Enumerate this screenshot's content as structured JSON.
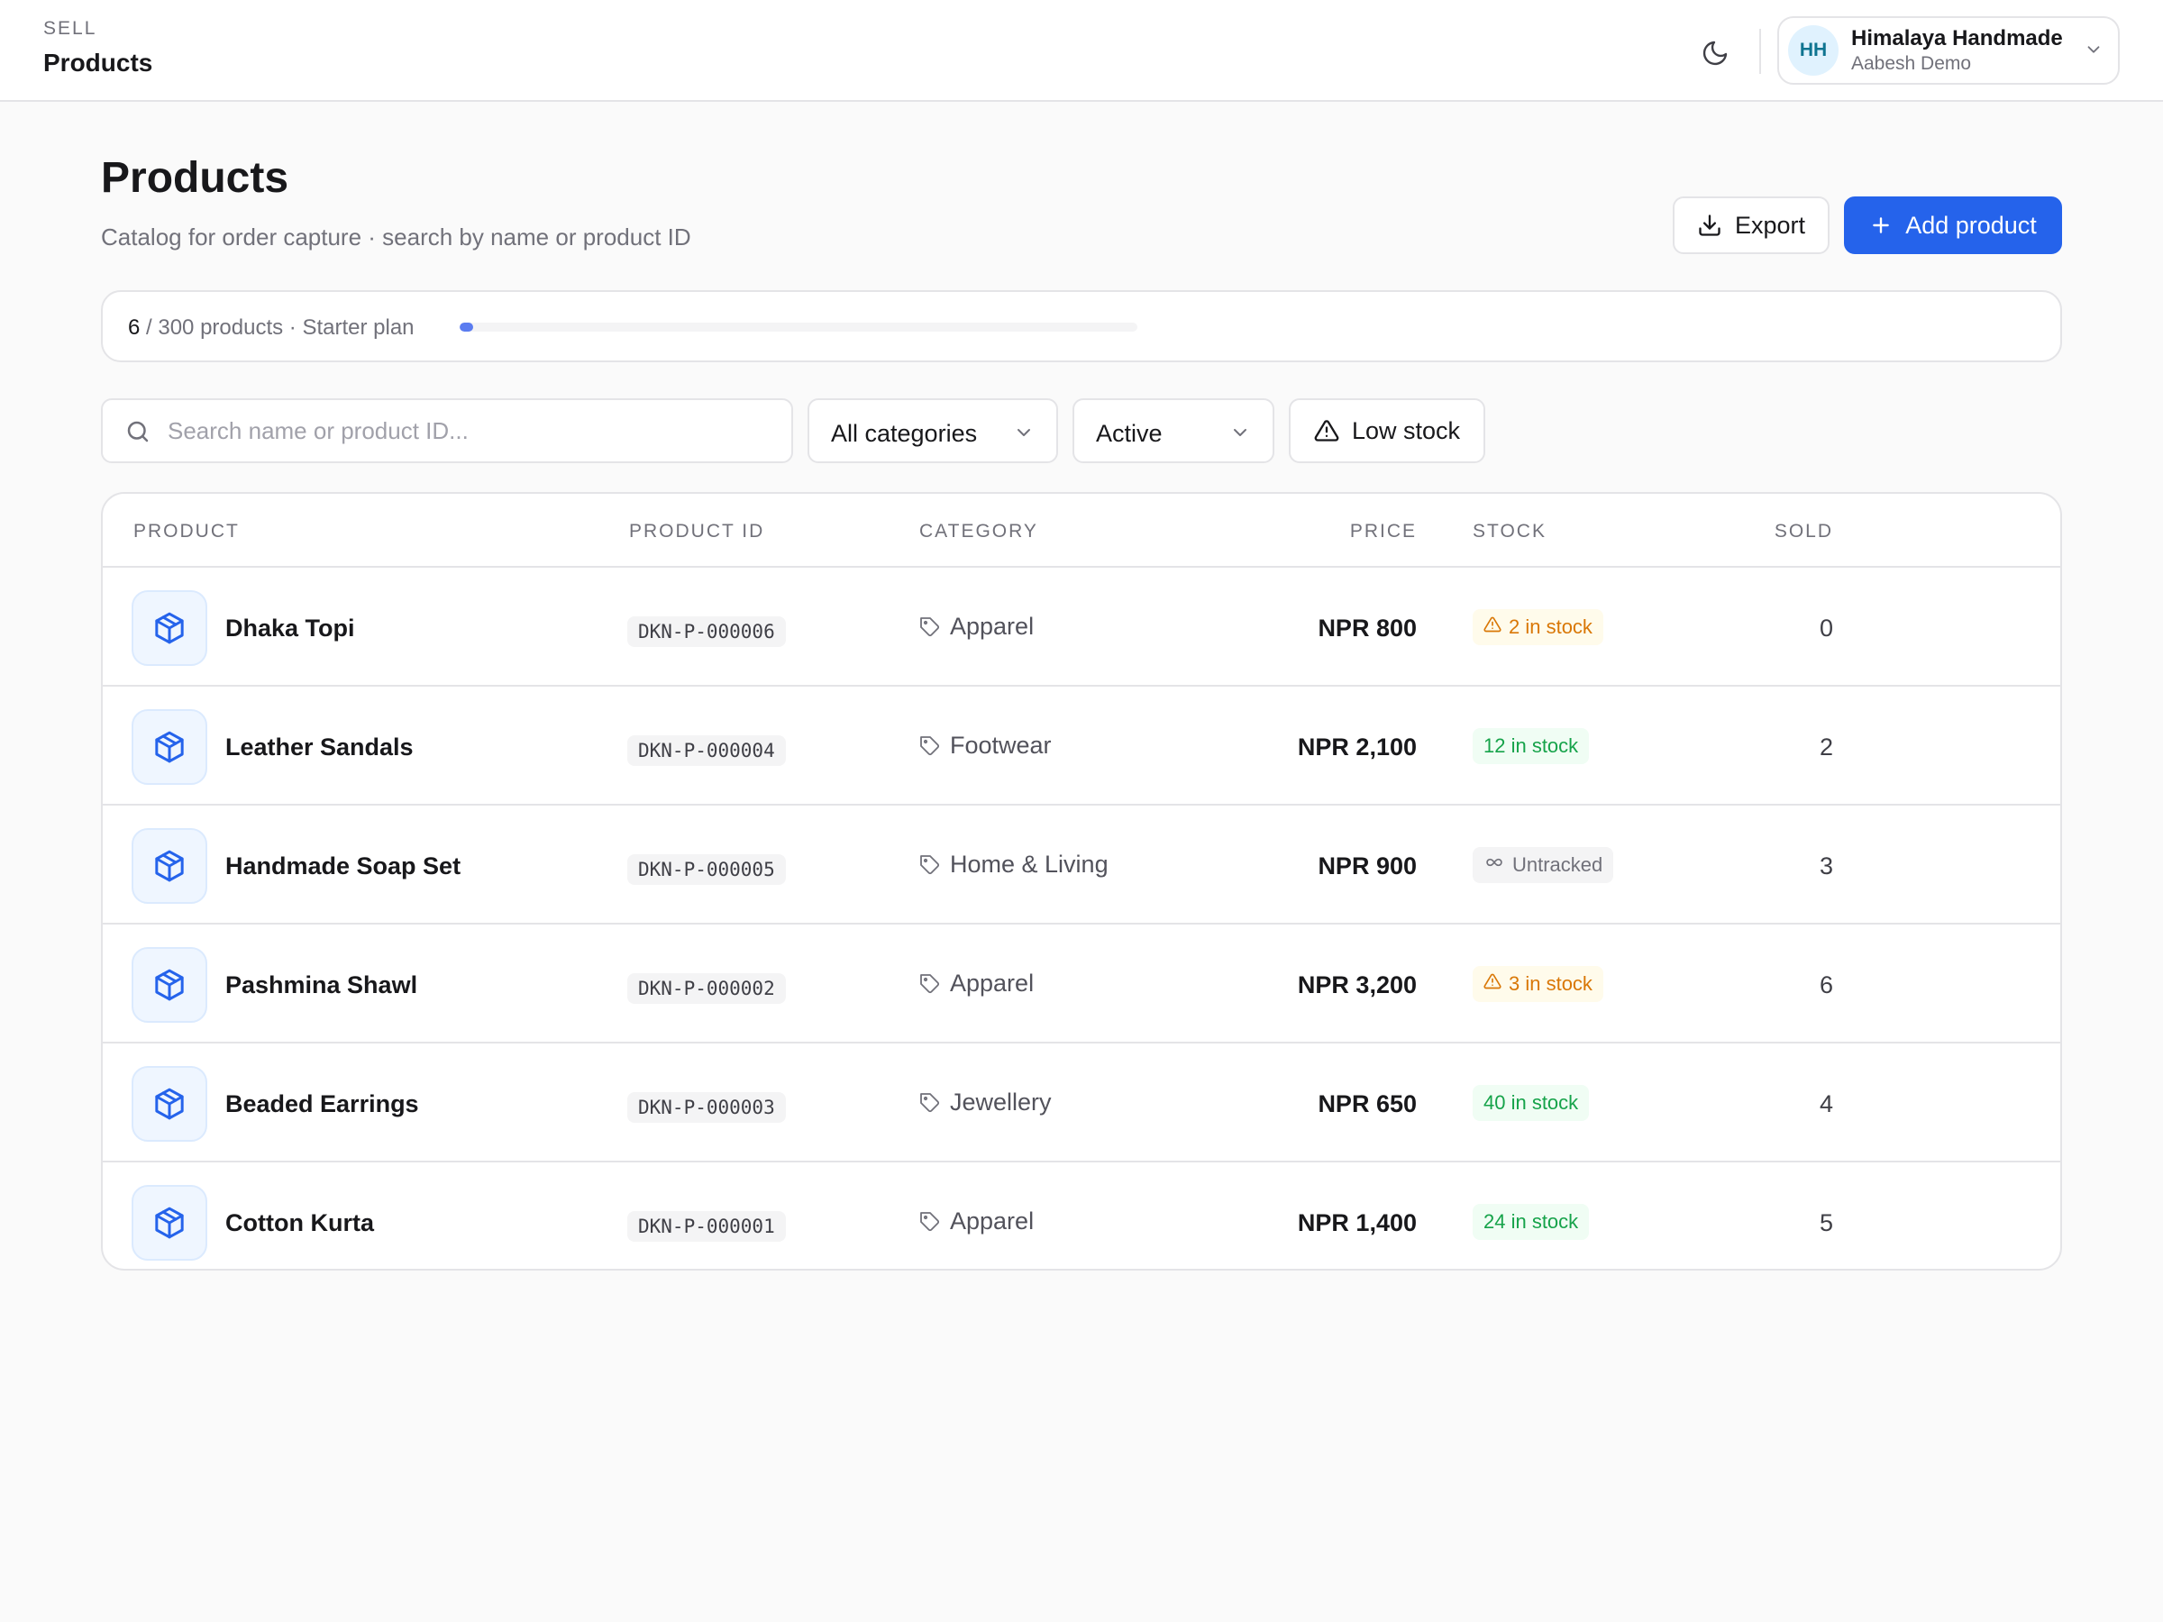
{
  "topbar": {
    "section": "SELL",
    "title": "Products",
    "theme_icon": "moon-icon",
    "account": {
      "initials": "HH",
      "name": "Himalaya Handmade",
      "subtitle": "Aabesh Demo"
    }
  },
  "header": {
    "title": "Products",
    "subtitle": "Catalog for order capture · search by name or product ID",
    "export_label": "Export",
    "add_label": "Add product"
  },
  "usage": {
    "count": "6",
    "rest": " / 300 products · Starter plan",
    "fraction": 0.02
  },
  "filters": {
    "search_placeholder": "Search name or product ID...",
    "search_value": "",
    "category_selected": "All categories",
    "status_selected": "Active",
    "low_stock_label": "Low stock"
  },
  "table": {
    "columns": {
      "product": "PRODUCT",
      "product_id": "PRODUCT ID",
      "category": "CATEGORY",
      "price": "PRICE",
      "stock": "STOCK",
      "sold": "SOLD"
    },
    "rows": [
      {
        "name": "Dhaka Topi",
        "id": "DKN-P-000006",
        "category": "Apparel",
        "price": "NPR 800",
        "stock": "2 in stock",
        "stock_status": "low",
        "sold": "0"
      },
      {
        "name": "Leather Sandals",
        "id": "DKN-P-000004",
        "category": "Footwear",
        "price": "NPR 2,100",
        "stock": "12 in stock",
        "stock_status": "ok",
        "sold": "2"
      },
      {
        "name": "Handmade Soap Set",
        "id": "DKN-P-000005",
        "category": "Home & Living",
        "price": "NPR 900",
        "stock": "Untracked",
        "stock_status": "untracked",
        "sold": "3"
      },
      {
        "name": "Pashmina Shawl",
        "id": "DKN-P-000002",
        "category": "Apparel",
        "price": "NPR 3,200",
        "stock": "3 in stock",
        "stock_status": "low",
        "sold": "6"
      },
      {
        "name": "Beaded Earrings",
        "id": "DKN-P-000003",
        "category": "Jewellery",
        "price": "NPR 650",
        "stock": "40 in stock",
        "stock_status": "ok",
        "sold": "4"
      },
      {
        "name": "Cotton Kurta",
        "id": "DKN-P-000001",
        "category": "Apparel",
        "price": "NPR 1,400",
        "stock": "24 in stock",
        "stock_status": "ok",
        "sold": "5"
      }
    ]
  },
  "colors": {
    "accent": "#2563eb",
    "low_stock": "#d97706",
    "in_stock": "#16a34a",
    "untracked": "#71717a"
  }
}
